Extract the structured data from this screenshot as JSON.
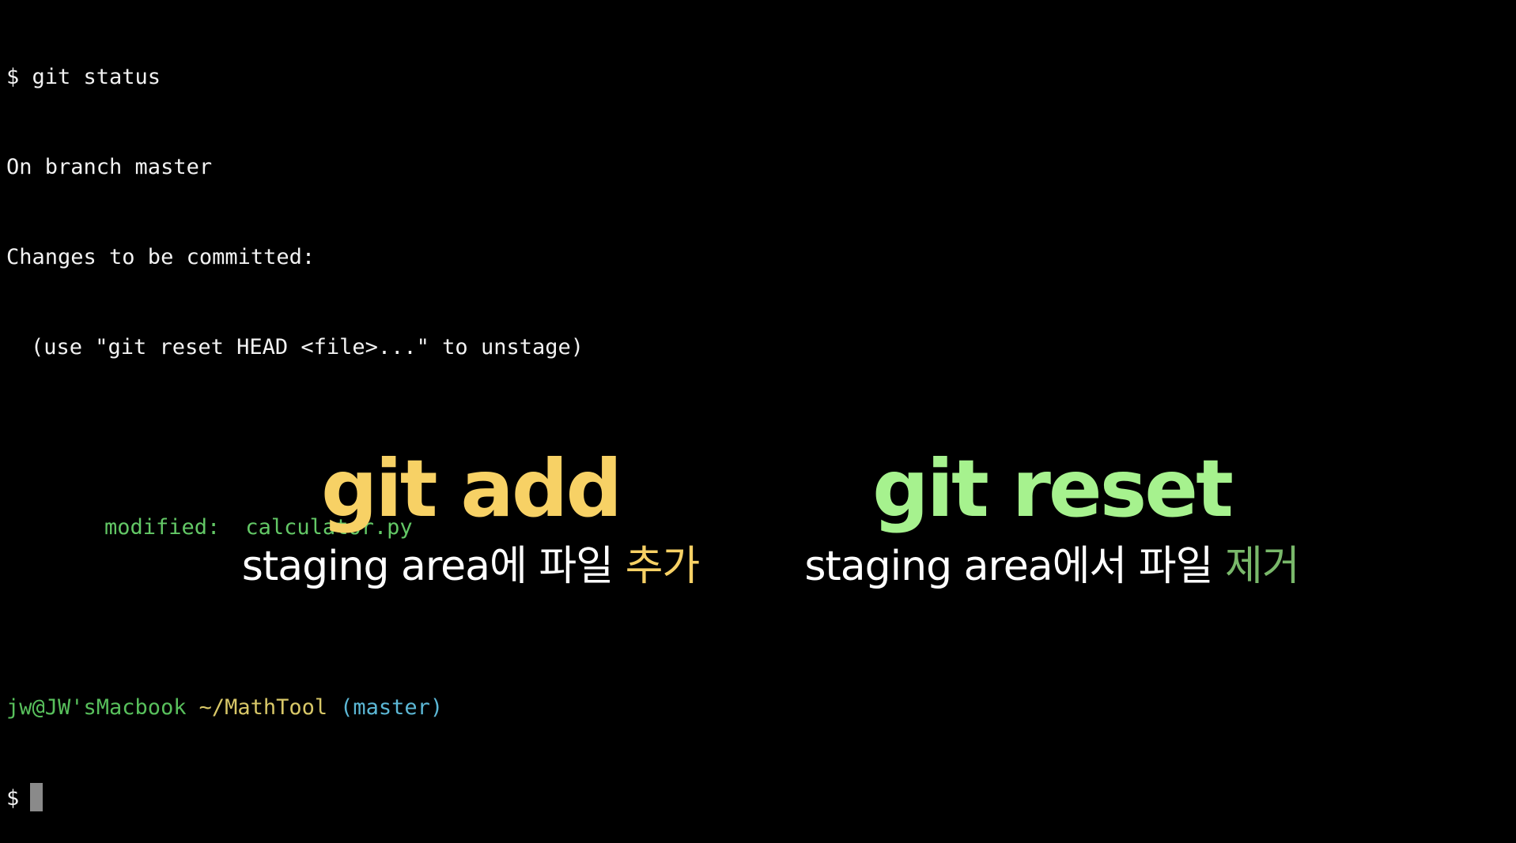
{
  "terminal": {
    "line1": "$ git status",
    "line2": "On branch master",
    "line3": "Changes to be committed:",
    "line4": "(use \"git reset HEAD <file>...\" to unstage)",
    "modified_label": "modified:",
    "modified_file": "calculator.py",
    "prompt_user_host": "jw@JW'sMacbook",
    "prompt_path": "~/MathTool",
    "prompt_branch": "(master)",
    "prompt_symbol": "$"
  },
  "captions": {
    "left": {
      "title": "git add",
      "title_color": "#f7d165",
      "sub_main": "staging area에 파일 ",
      "sub_highlight": "추가",
      "highlight_color": "#f7d165"
    },
    "right": {
      "title": "git reset",
      "title_color": "#a6f28e",
      "sub_main": "staging area에서 파일 ",
      "sub_highlight": "제거",
      "highlight_color": "#79b86a"
    }
  },
  "colors": {
    "background": "#000000",
    "terminal_text": "#f2f2f2",
    "terminal_green": "#63c866",
    "prompt_path": "#d9c868",
    "prompt_branch": "#5cb8d6"
  }
}
